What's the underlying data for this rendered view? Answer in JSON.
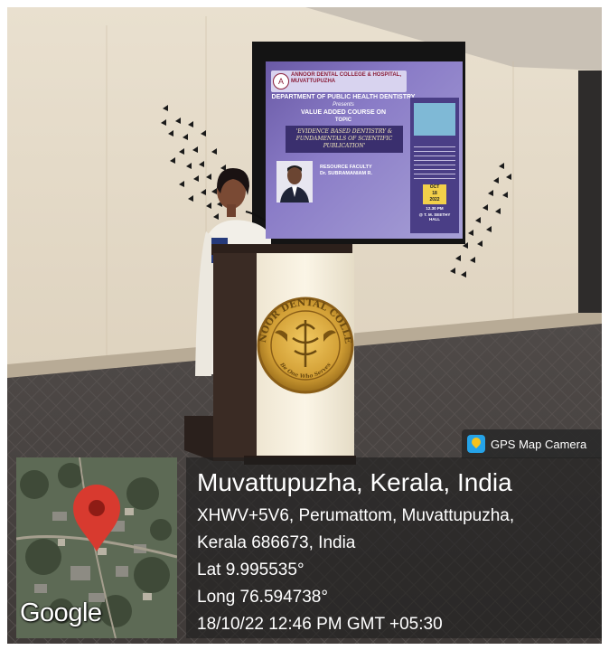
{
  "slide": {
    "logo_glyph": "A",
    "college": "ANNOOR DENTAL COLLEGE & HOSPITAL, MUVATTUPUZHA",
    "department": "DEPARTMENT OF PUBLIC HEALTH DENTISTRY",
    "presents": "Presents",
    "course": "VALUE ADDED COURSE ON",
    "topic_label": "TOPIC",
    "topic": "'EVIDENCE BASED DENTISTRY & FUNDAMENTALS OF SCIENTIFIC PUBLICATION'",
    "resource_label": "RESOURCE FACULTY",
    "resource_name": "Dr. SUBRAMANIAM R.",
    "month": "OCT",
    "day": "18",
    "year": "2022",
    "time": "12.30 PM",
    "venue": "@ T. M. SEETHY HALL"
  },
  "podium": {
    "emblem_text": "ANNOOR DENTAL COLLEGE",
    "emblem_motto": "Be One Who Serves"
  },
  "overlay": {
    "app_name": "GPS Map Camera",
    "map_brand": "Google",
    "city": "Muvattupuzha, Kerala, India",
    "address_line1": "XHWV+5V6, Perumattom, Muvattupuzha,",
    "address_line2": "Kerala 686673, India",
    "lat": "Lat 9.995535°",
    "long": "Long 76.594738°",
    "datetime": "18/10/22 12:46 PM GMT +05:30"
  },
  "colors": {
    "pin": "#d83a2f",
    "podium_wood": "#3a2b24",
    "emblem_gold": "#c99a2e"
  }
}
